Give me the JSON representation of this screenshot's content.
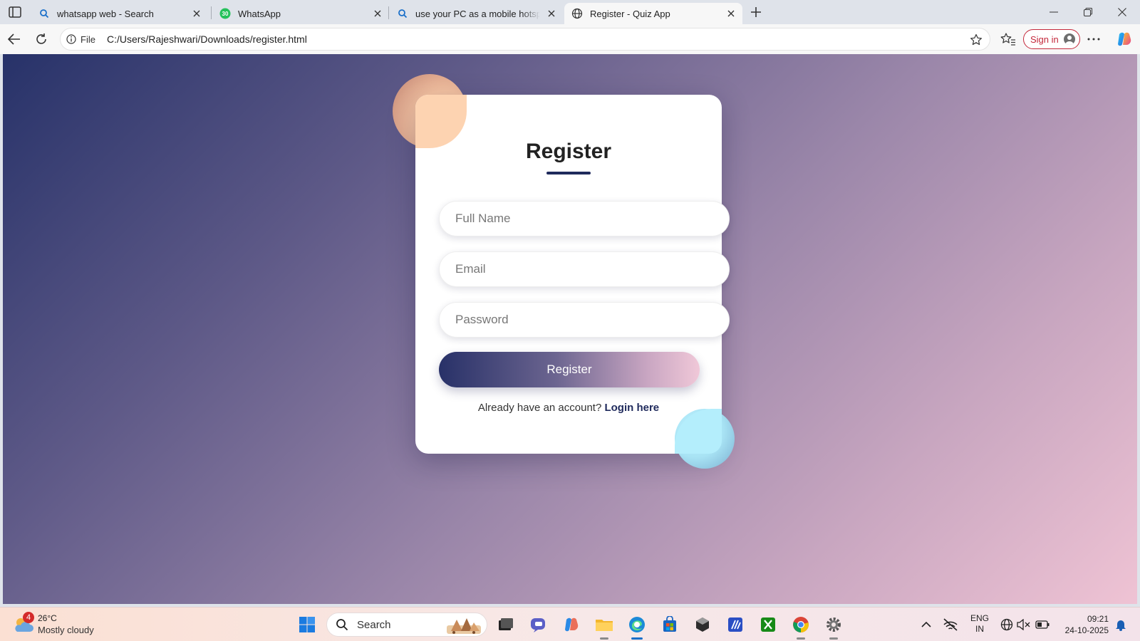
{
  "browser": {
    "tabs": [
      {
        "title": "whatsapp web - Search",
        "icon": "search-icon"
      },
      {
        "title": "WhatsApp",
        "icon": "whatsapp-icon",
        "badge": "30"
      },
      {
        "title": "use your PC as a mobile hotspot w",
        "icon": "search-icon"
      },
      {
        "title": "Register - Quiz App",
        "icon": "globe-icon",
        "active": true
      }
    ],
    "address": {
      "scheme_label": "File",
      "url": "C:/Users/Rajeshwari/Downloads/register.html"
    },
    "signin_label": "Sign in"
  },
  "page": {
    "title": "Register",
    "fields": {
      "full_name_placeholder": "Full Name",
      "email_placeholder": "Email",
      "password_placeholder": "Password"
    },
    "submit_label": "Register",
    "login_prompt": "Already have an account?",
    "login_link": "Login here"
  },
  "taskbar": {
    "weather": {
      "temp": "26°C",
      "desc": "Mostly cloudy",
      "badge": "4"
    },
    "search_label": "Search",
    "pinned": [
      "start-icon",
      "task-view-icon",
      "teams-icon",
      "copilot-icon",
      "file-explorer-icon",
      "edge-icon",
      "store-icon",
      "app-icon",
      "vscode-icon",
      "xbox-icon",
      "chrome-icon",
      "settings-icon"
    ],
    "tray": {
      "lang_line1": "ENG",
      "lang_line2": "IN"
    },
    "clock": {
      "time": "09:21",
      "date": "24-10-2025"
    }
  },
  "colors": {
    "accent": "#1f2a5c",
    "gradient_start": "#273269",
    "gradient_end": "#efc3d4",
    "signin_red": "#c4283b"
  }
}
